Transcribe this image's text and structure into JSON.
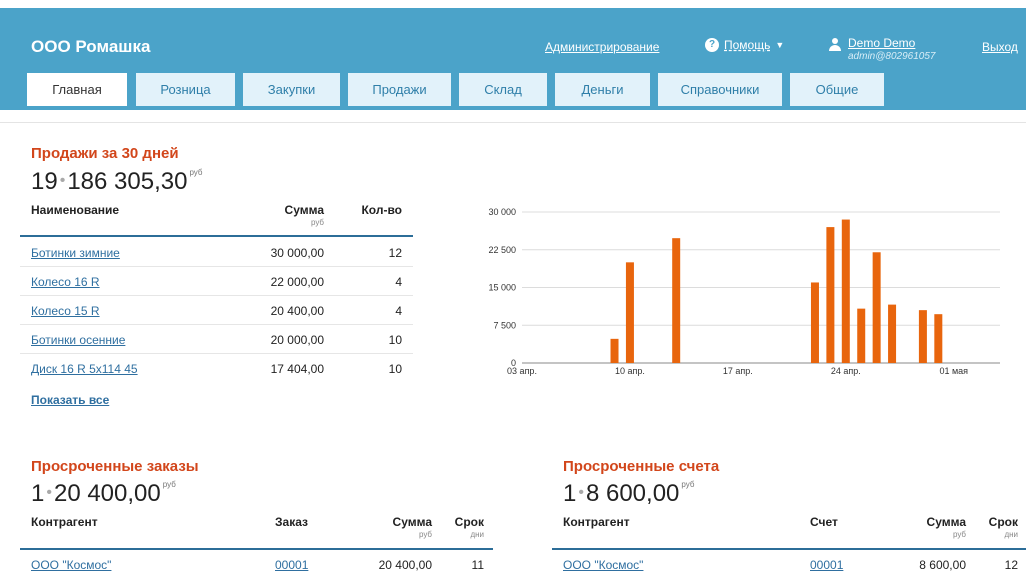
{
  "header": {
    "company": "ООО Ромашка",
    "admin_link": "Администрирование",
    "help_label": "Помощь",
    "help_icon": "question-circle-icon",
    "user_name": "Demo Demo",
    "user_sub": "admin@802961057",
    "logout": "Выход"
  },
  "tabs": [
    {
      "label": "Главная",
      "active": true
    },
    {
      "label": "Розница",
      "active": false
    },
    {
      "label": "Закупки",
      "active": false
    },
    {
      "label": "Продажи",
      "active": false
    },
    {
      "label": "Склад",
      "active": false
    },
    {
      "label": "Деньги",
      "active": false
    },
    {
      "label": "Справочники",
      "active": false
    },
    {
      "label": "Общие",
      "active": false
    }
  ],
  "sales": {
    "title": "Продажи за 30 дней",
    "count": "19",
    "total": "186 305,30",
    "currency": "руб",
    "columns": {
      "name": "Наименование",
      "sum": "Сумма",
      "sum_unit": "руб",
      "qty": "Кол-во"
    },
    "rows": [
      {
        "name": "Ботинки зимние",
        "sum": "30 000,00",
        "qty": "12"
      },
      {
        "name": "Колесо 16 R",
        "sum": "22 000,00",
        "qty": "4"
      },
      {
        "name": "Колесо 15 R",
        "sum": "20 400,00",
        "qty": "4"
      },
      {
        "name": "Ботинки осенние",
        "sum": "20 000,00",
        "qty": "10"
      },
      {
        "name": "Диск 16 R 5x114 45",
        "sum": "17 404,00",
        "qty": "10"
      }
    ],
    "show_all": "Показать все"
  },
  "chart_data": {
    "type": "bar",
    "title": "",
    "xlabel": "",
    "ylabel": "",
    "ylim": [
      0,
      30000
    ],
    "yticks": [
      0,
      7500,
      15000,
      22500,
      30000
    ],
    "ytick_labels": [
      "0",
      "7 500",
      "15 000",
      "22 500",
      "30 000"
    ],
    "xticks": [
      0,
      7,
      14,
      21,
      28
    ],
    "xtick_labels": [
      "03 апр.",
      "10 апр.",
      "17 апр.",
      "24 апр.",
      "01 мая"
    ],
    "x_range": [
      0,
      31
    ],
    "grid": true,
    "color": "#e8650d",
    "series": [
      {
        "x": [
          6,
          7,
          10,
          19,
          20,
          21,
          22,
          23,
          24,
          26,
          27
        ],
        "values": [
          4800,
          20000,
          24800,
          16000,
          27000,
          28500,
          10800,
          22000,
          11600,
          10500,
          9700
        ]
      }
    ]
  },
  "overdue_orders": {
    "title": "Просроченные заказы",
    "count": "1",
    "total": "20 400,00",
    "currency": "руб",
    "columns": {
      "party": "Контрагент",
      "doc": "Заказ",
      "sum": "Сумма",
      "sum_unit": "руб",
      "term": "Срок",
      "term_unit": "дни"
    },
    "rows": [
      {
        "party": "ООО \"Космос\"",
        "doc": "00001",
        "sum": "20 400,00",
        "term": "11"
      }
    ]
  },
  "overdue_invoices": {
    "title": "Просроченные счета",
    "count": "1",
    "total": "8 600,00",
    "currency": "руб",
    "columns": {
      "party": "Контрагент",
      "doc": "Счет",
      "sum": "Сумма",
      "sum_unit": "руб",
      "term": "Срок",
      "term_unit": "дни"
    },
    "rows": [
      {
        "party": "ООО \"Космос\"",
        "doc": "00001",
        "sum": "8 600,00",
        "term": "12"
      }
    ]
  }
}
